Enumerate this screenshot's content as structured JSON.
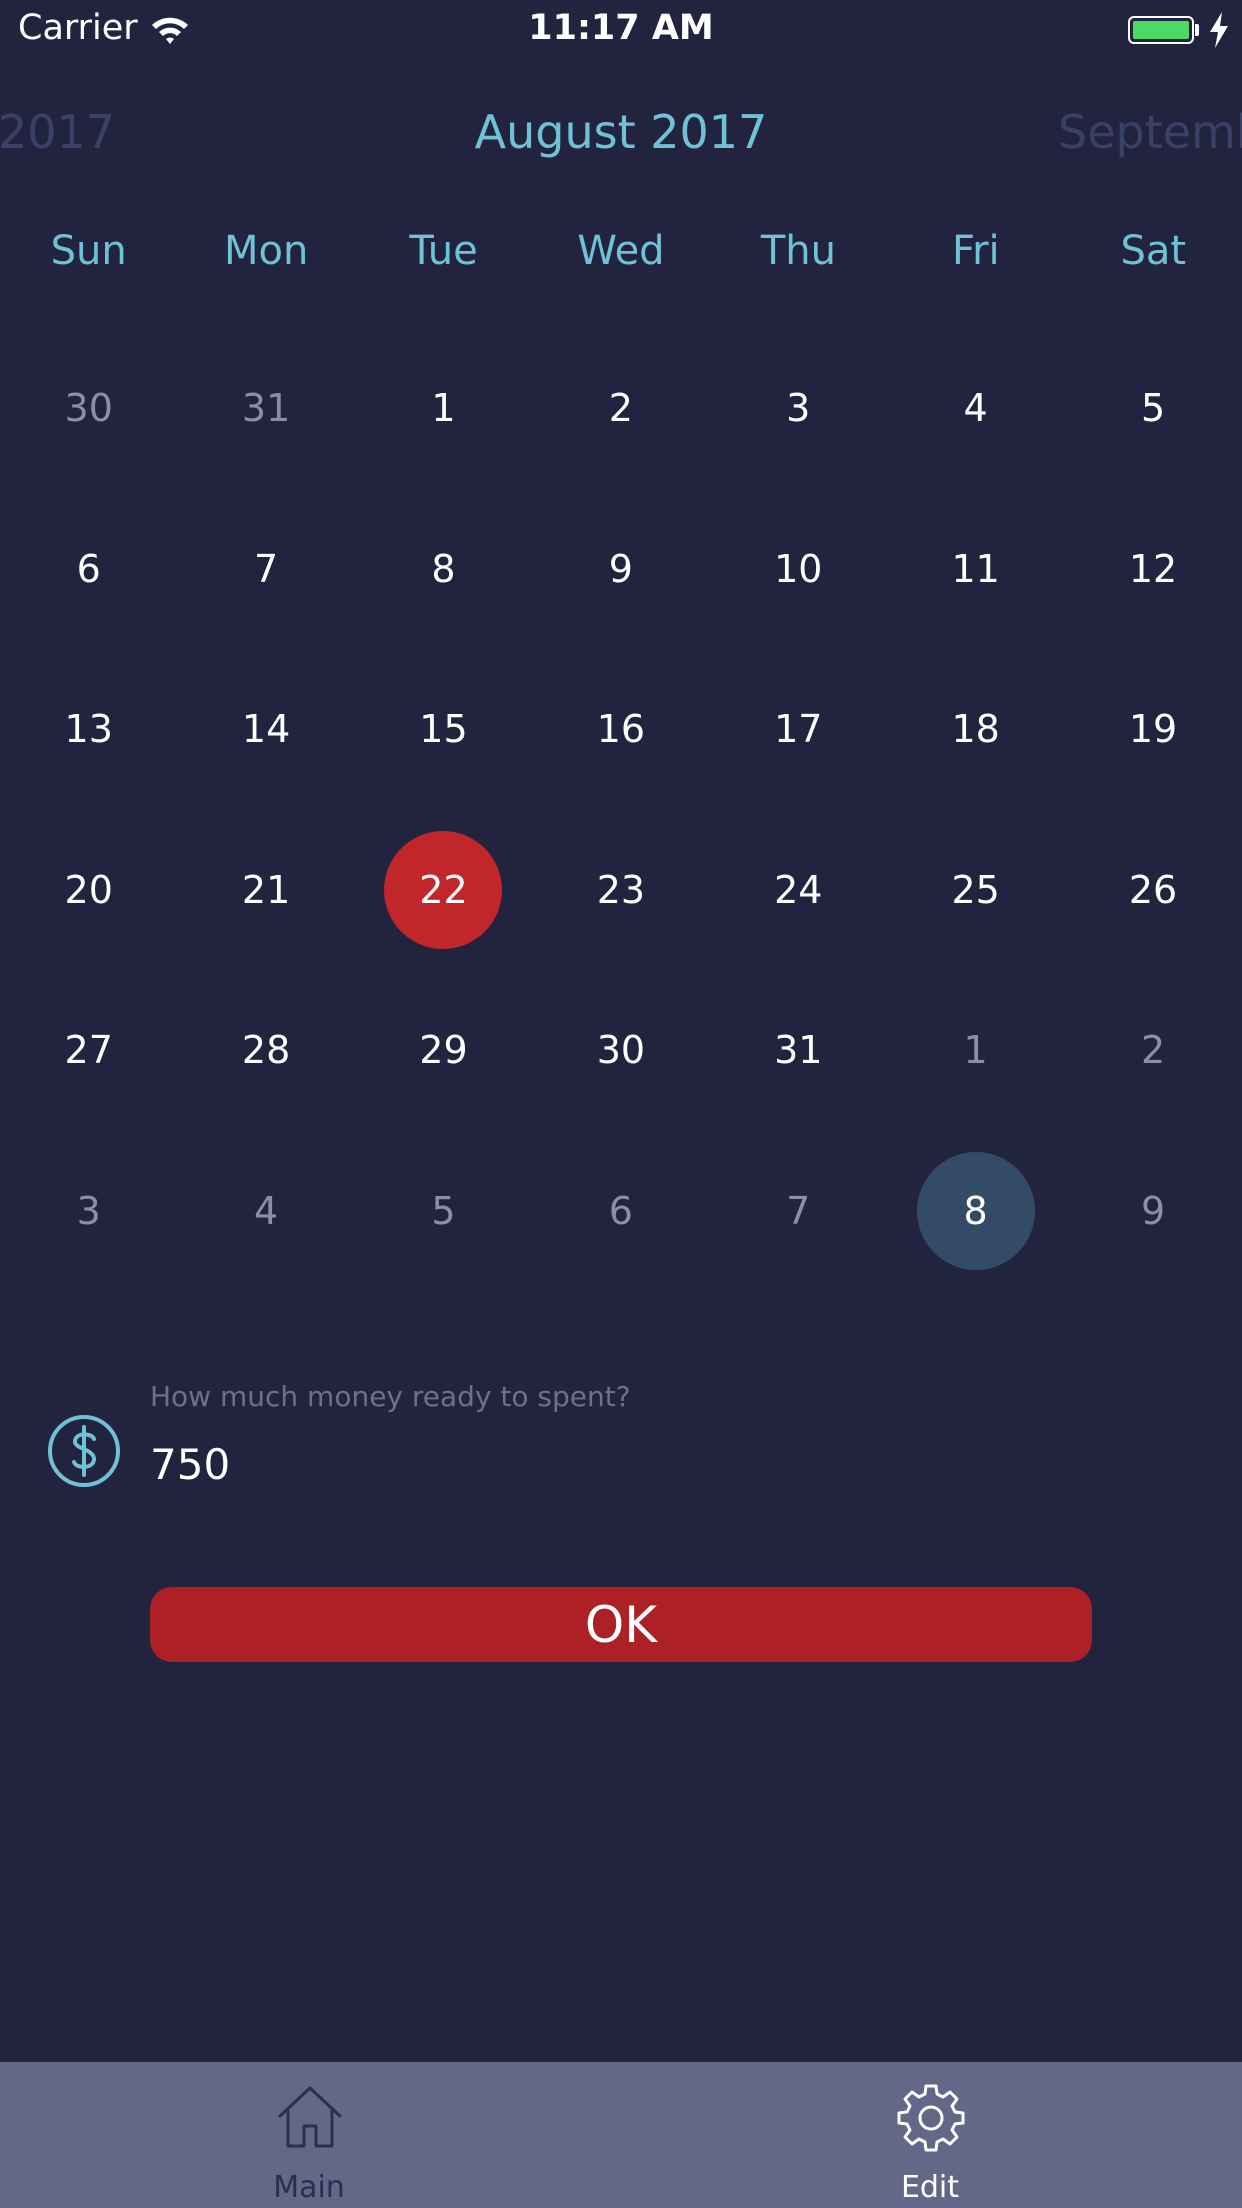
{
  "status_bar": {
    "carrier": "Carrier",
    "time": "11:17 AM"
  },
  "calendar": {
    "prev_month": "2017",
    "current_month": "August 2017",
    "next_month": "Septemb",
    "weekdays": [
      "Sun",
      "Mon",
      "Tue",
      "Wed",
      "Thu",
      "Fri",
      "Sat"
    ],
    "weeks": [
      [
        {
          "d": "30",
          "muted": true
        },
        {
          "d": "31",
          "muted": true
        },
        {
          "d": "1"
        },
        {
          "d": "2"
        },
        {
          "d": "3"
        },
        {
          "d": "4"
        },
        {
          "d": "5"
        }
      ],
      [
        {
          "d": "6"
        },
        {
          "d": "7"
        },
        {
          "d": "8"
        },
        {
          "d": "9"
        },
        {
          "d": "10"
        },
        {
          "d": "11"
        },
        {
          "d": "12"
        }
      ],
      [
        {
          "d": "13"
        },
        {
          "d": "14"
        },
        {
          "d": "15"
        },
        {
          "d": "16"
        },
        {
          "d": "17"
        },
        {
          "d": "18"
        },
        {
          "d": "19"
        }
      ],
      [
        {
          "d": "20"
        },
        {
          "d": "21"
        },
        {
          "d": "22",
          "today": true
        },
        {
          "d": "23"
        },
        {
          "d": "24"
        },
        {
          "d": "25"
        },
        {
          "d": "26"
        }
      ],
      [
        {
          "d": "27"
        },
        {
          "d": "28"
        },
        {
          "d": "29"
        },
        {
          "d": "30"
        },
        {
          "d": "31"
        },
        {
          "d": "1",
          "muted": true
        },
        {
          "d": "2",
          "muted": true
        }
      ],
      [
        {
          "d": "3",
          "muted": true
        },
        {
          "d": "4",
          "muted": true
        },
        {
          "d": "5",
          "muted": true
        },
        {
          "d": "6",
          "muted": true
        },
        {
          "d": "7",
          "muted": true
        },
        {
          "d": "8",
          "muted": true,
          "selected": true
        },
        {
          "d": "9",
          "muted": true
        }
      ]
    ]
  },
  "money": {
    "icon": "dollar-circle-icon",
    "label": "How much money ready to spent?",
    "value": "750"
  },
  "ok_button": {
    "label": "OK"
  },
  "tab_bar": {
    "tabs": [
      {
        "label": "Main",
        "icon": "home-icon",
        "active": false
      },
      {
        "label": "Edit",
        "icon": "gear-icon",
        "active": true
      }
    ]
  },
  "colors": {
    "background": "#22243f",
    "accent": "#6fc1d6",
    "today": "#c0262a",
    "selected": "#344b67",
    "button": "#ad2126",
    "tab_bar": "#636788",
    "battery": "#4cd964"
  }
}
